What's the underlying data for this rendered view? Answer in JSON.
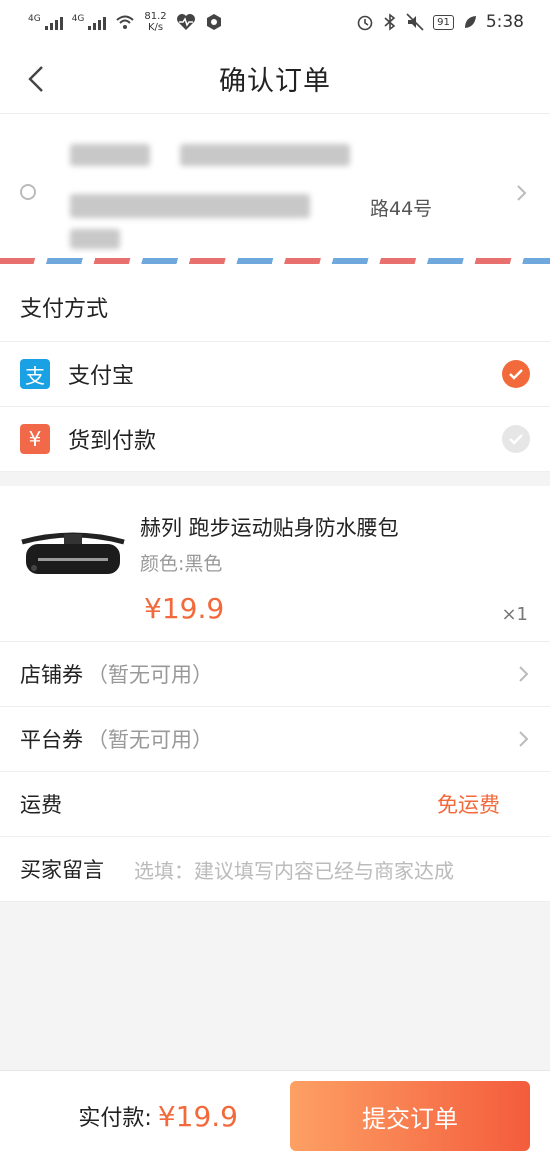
{
  "status_bar": {
    "net1": "4G",
    "net2": "4G",
    "speed_value": "81.2",
    "speed_unit": "K/s",
    "battery": "91",
    "time": "5:38"
  },
  "nav": {
    "title": "确认订单"
  },
  "address": {
    "visible_fragment": "路44号"
  },
  "payment": {
    "header": "支付方式",
    "methods": [
      {
        "label": "支付宝",
        "icon": "alipay-icon",
        "icon_glyph": "支",
        "color": "#1aa1e4",
        "selected": true
      },
      {
        "label": "货到付款",
        "icon": "cash-on-delivery-icon",
        "icon_glyph": "¥",
        "color": "#f2694a",
        "selected": false
      }
    ]
  },
  "product": {
    "name": "赫列 跑步运动贴身防水腰包",
    "spec": "颜色:黑色",
    "price": "¥19.9",
    "quantity": "×1"
  },
  "options": {
    "store_coupon_label": "店铺券",
    "store_coupon_value": "（暂无可用）",
    "platform_coupon_label": "平台券",
    "platform_coupon_value": "（暂无可用）",
    "shipping_label": "运费",
    "shipping_value": "免运费",
    "message_label": "买家留言",
    "message_placeholder": "选填：建议填写内容已经与商家达成"
  },
  "footer": {
    "total_label": "实付款:",
    "total_value": "¥19.9",
    "submit_label": "提交订单"
  },
  "colors": {
    "accent": "#f26a3b",
    "alipay": "#1aa1e4"
  }
}
